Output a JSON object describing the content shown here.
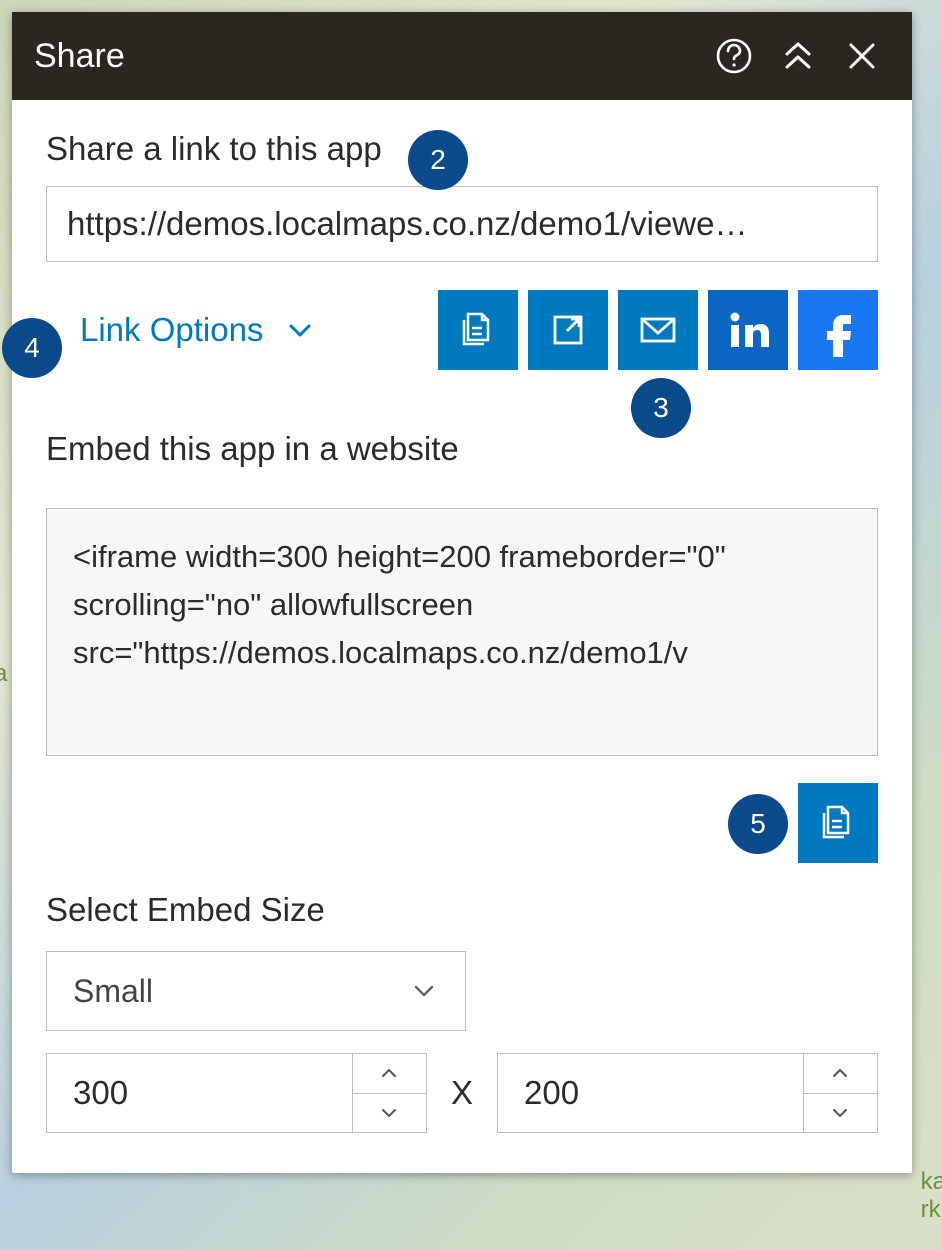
{
  "bg": {
    "label_left": "a",
    "label_right": "ka\nrk"
  },
  "titlebar": {
    "title": "Share"
  },
  "share_link": {
    "heading": "Share a link to this app",
    "url": "https://demos.localmaps.co.nz/demo1/viewe…"
  },
  "link_options": {
    "label": "Link Options"
  },
  "embed": {
    "heading": "Embed this app in a website",
    "code": "<iframe width=300 height=200 frameborder=\"0\" scrolling=\"no\" allowfullscreen src=\"https://demos.localmaps.co.nz/demo1/v"
  },
  "size": {
    "heading": "Select Embed Size",
    "preset": "Small",
    "width": "300",
    "separator": "X",
    "height": "200"
  },
  "callouts": {
    "c2": "2",
    "c3": "3",
    "c4": "4",
    "c5": "5"
  },
  "icons": {
    "help": "help-icon",
    "collapse": "chevron-double-up-icon",
    "close": "close-icon",
    "chevron_down": "chevron-down-icon",
    "copy": "copy-icon",
    "open": "open-external-icon",
    "email": "email-icon",
    "linkedin": "linkedin-icon",
    "facebook": "facebook-icon",
    "caret_up": "caret-up-icon",
    "caret_down": "caret-down-icon"
  }
}
